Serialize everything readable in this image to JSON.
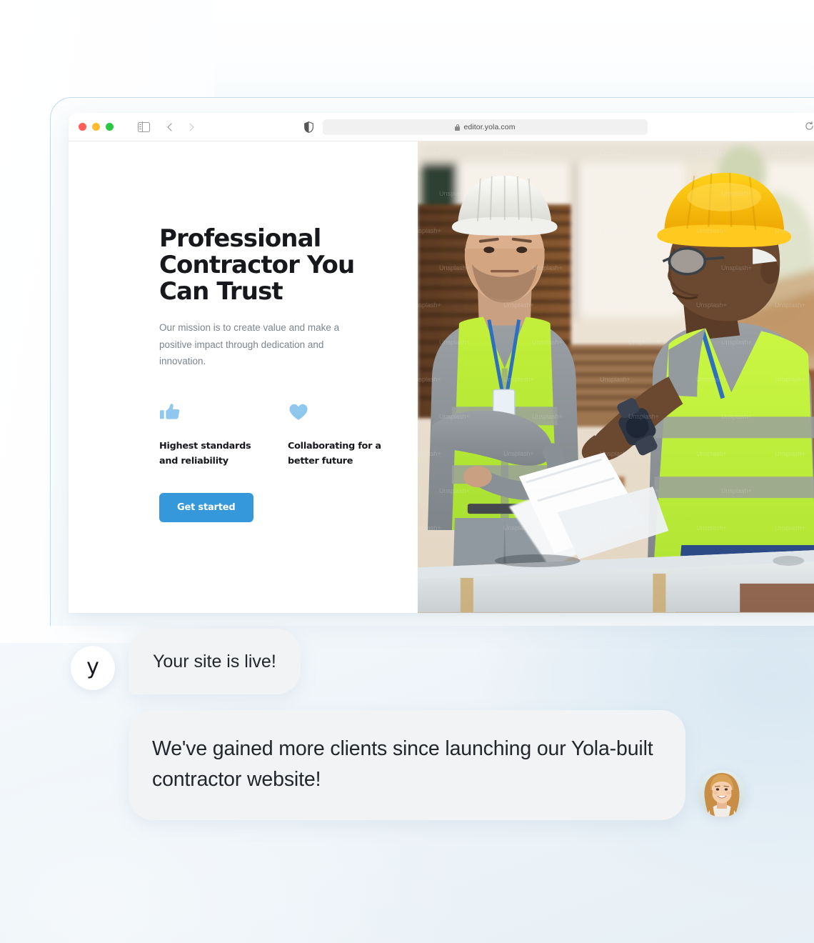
{
  "browser": {
    "window_controls": [
      "close",
      "minimize",
      "maximize"
    ],
    "sidebar_icon": "sidebar-toggle-icon",
    "back_icon": "chevron-left-icon",
    "forward_icon": "chevron-right-icon",
    "shield_icon": "privacy-shield-icon",
    "lock_icon": "lock-icon",
    "url": "editor.yola.com",
    "reload_icon": "reload-icon"
  },
  "site": {
    "title": "Professional Contractor You Can Trust",
    "subtitle": "Our mission is to create value and make a positive impact through dedication and innovation.",
    "features": [
      {
        "icon": "thumbs-up-icon",
        "label": "Highest standards and reliability",
        "color": "#8fc8ec"
      },
      {
        "icon": "heart-icon",
        "label": "Collaborating for a better future",
        "color": "#8fc8ec"
      }
    ],
    "cta_label": "Get started",
    "cta_color": "#3498db",
    "hero_image_alt": "Two construction workers in high-visibility vests and hard hats reviewing plans in a lumber yard",
    "hero_watermark": "Unsplash+"
  },
  "chat": {
    "messages": [
      {
        "avatar": "yola-logo-avatar",
        "avatar_glyph": "y",
        "text": "Your site is live!"
      },
      {
        "avatar": "customer-photo-avatar",
        "text": "We've gained more clients since launching our Yola-built contractor website!"
      }
    ]
  },
  "colors": {
    "accent": "#3498db",
    "icon_blue": "#8fc8ec",
    "bubble_bg": "#f1f3f5",
    "frame_border": "#bfdcf0",
    "page_bg_right": "#dbe9f3"
  }
}
